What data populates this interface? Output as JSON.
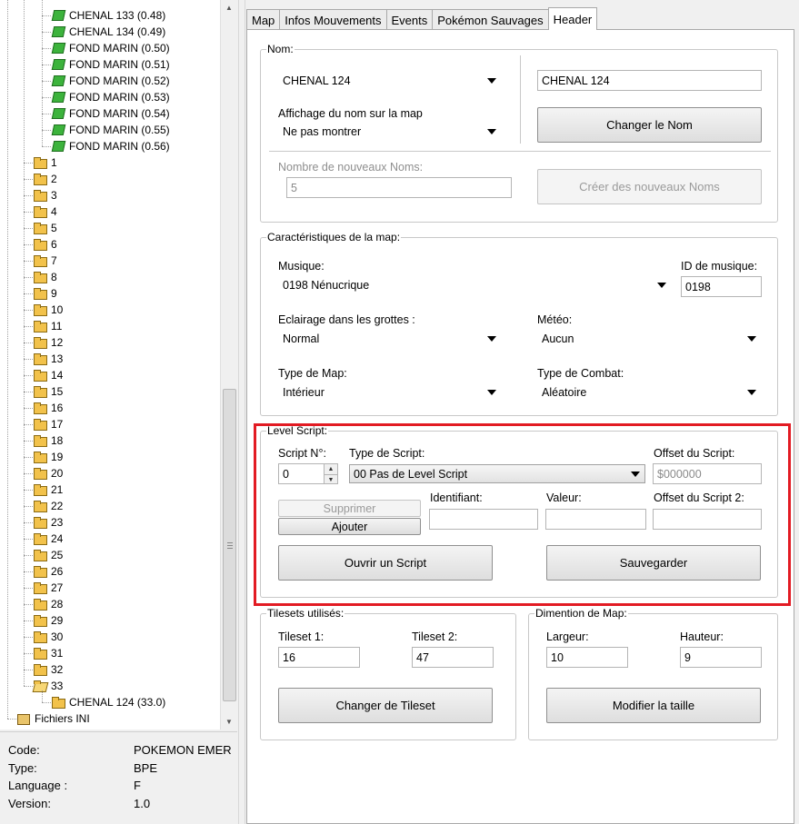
{
  "tree": {
    "maps": [
      "CHENAL 133 (0.48)",
      "CHENAL 134 (0.49)",
      "FOND MARIN (0.50)",
      "FOND MARIN (0.51)",
      "FOND MARIN (0.52)",
      "FOND MARIN (0.53)",
      "FOND MARIN (0.54)",
      "FOND MARIN (0.55)",
      "FOND MARIN (0.56)"
    ],
    "banks": [
      "1",
      "2",
      "3",
      "4",
      "5",
      "6",
      "7",
      "8",
      "9",
      "10",
      "11",
      "12",
      "13",
      "14",
      "15",
      "16",
      "17",
      "18",
      "19",
      "20",
      "21",
      "22",
      "23",
      "24",
      "25",
      "26",
      "27",
      "28",
      "29",
      "30",
      "31",
      "32",
      "33"
    ],
    "bank33_child": "CHENAL 124 (33.0)",
    "ini_label": "Fichiers INI"
  },
  "rom_info": {
    "code_label": "Code:",
    "code_value": "POKEMON EMER",
    "type_label": "Type:",
    "type_value": "BPE",
    "language_label": "Language :",
    "language_value": "F",
    "version_label": "Version:",
    "version_value": "1.0"
  },
  "tabs": [
    "Map",
    "Infos Mouvements",
    "Events",
    "Pokémon Sauvages",
    "Header"
  ],
  "active_tab": "Header",
  "nom": {
    "legend": "Nom:",
    "name_select": "CHENAL 124",
    "name_input": "CHENAL 124",
    "change_button": "Changer le Nom",
    "display_label": "Affichage du nom sur la map",
    "display_select": "Ne pas montrer",
    "count_label": "Nombre de nouveaux Noms:",
    "count_value": "5",
    "create_button": "Créer des nouveaux Noms"
  },
  "caract": {
    "legend": "Caractéristiques de la map:",
    "music_label": "Musique:",
    "music_value": "0198 Nénucrique",
    "music_id_label": "ID de musique:",
    "music_id_value": "0198",
    "cave_label": "Eclairage dans les grottes :",
    "cave_value": "Normal",
    "weather_label": "Météo:",
    "weather_value": "Aucun",
    "maptype_label": "Type de Map:",
    "maptype_value": "Intérieur",
    "battle_label": "Type de Combat:",
    "battle_value": "Aléatoire"
  },
  "level_script": {
    "legend": "Level Script:",
    "num_label": "Script N°:",
    "num_value": "0",
    "type_label": "Type de Script:",
    "type_value": "00 Pas de Level Script",
    "offset_label": "Offset du Script:",
    "offset_value": "$000000",
    "delete_button": "Supprimer",
    "add_button": "Ajouter",
    "id_label": "Identifiant:",
    "value_label": "Valeur:",
    "offset2_label": "Offset du Script 2:",
    "open_button": "Ouvrir un Script",
    "save_button": "Sauvegarder"
  },
  "tilesets": {
    "legend": "Tilesets utilisés:",
    "t1_label": "Tileset 1:",
    "t1_value": "16",
    "t2_label": "Tileset 2:",
    "t2_value": "47",
    "change_button": "Changer de Tileset"
  },
  "dimension": {
    "legend": "Dimention de Map:",
    "width_label": "Largeur:",
    "width_value": "10",
    "height_label": "Hauteur:",
    "height_value": "9",
    "resize_button": "Modifier la taille"
  },
  "colors": {
    "highlight": "#e21b23",
    "map_icon": "#3cb33c",
    "folder_icon": "#f2c24b"
  }
}
